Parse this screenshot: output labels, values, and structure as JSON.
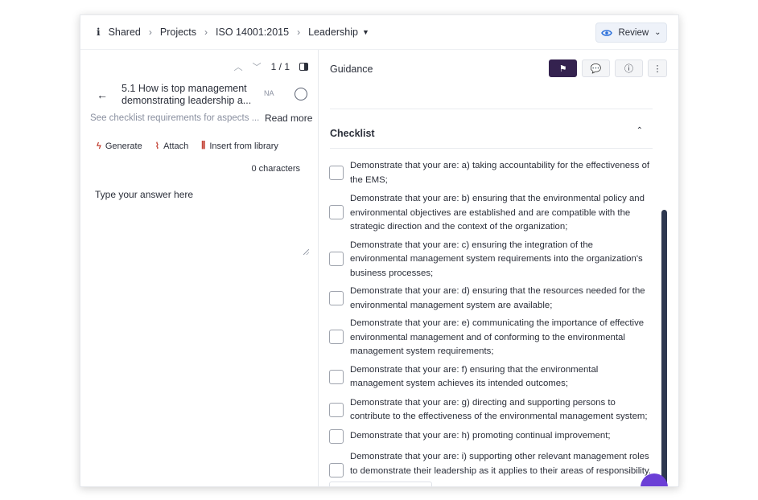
{
  "breadcrumb": {
    "info_icon": "i",
    "items": [
      "Shared",
      "Projects",
      "ISO 14001:2015",
      "Leadership"
    ]
  },
  "review_button": {
    "label": "Review",
    "icon": "eye-icon"
  },
  "pager": {
    "text": "1 / 1"
  },
  "question": {
    "text": "5.1 How is top management demonstrating leadership a...",
    "na_label": "NA"
  },
  "hint": "See checklist requirements for aspects ...",
  "read_more": "Read more",
  "tools": {
    "generate": "Generate",
    "attach": "Attach",
    "insert": "Insert from library"
  },
  "char_count": "0 characters",
  "answer": {
    "placeholder": "Type your answer here"
  },
  "guidance": {
    "title": "Guidance"
  },
  "checklist": {
    "title": "Checklist",
    "items": [
      "Demonstrate that your are: a) taking accountability for the effectiveness of the EMS;",
      "Demonstrate that your are: b) ensuring that the environmental policy and environmental objectives are established and are compatible with the strategic direction and the context of the organization;",
      "Demonstrate that your are: c) ensuring the integration of the environmental management system requirements into the organization's business processes;",
      "Demonstrate that your are: d) ensuring that the resources needed for the environmental management system are available;",
      "Demonstrate that your are: e) communicating the importance of effective environmental management and of conforming to the environmental management system requirements;",
      "Demonstrate that your are: f) ensuring that the environmental management system achieves its intended outcomes;",
      "Demonstrate that your are: g) directing and supporting persons to contribute to the effectiveness of the environmental management system;",
      "Demonstrate that your are: h) promoting continual improvement;",
      "Demonstrate that your are: i) supporting other relevant management roles to demonstrate their leadership as it applies to their areas of responsibility."
    ]
  },
  "colors": {
    "accent": "#34224f",
    "fab": "#6b3fd6",
    "tool_icon": "#c0392b",
    "scrollbar": "#2e3850"
  }
}
